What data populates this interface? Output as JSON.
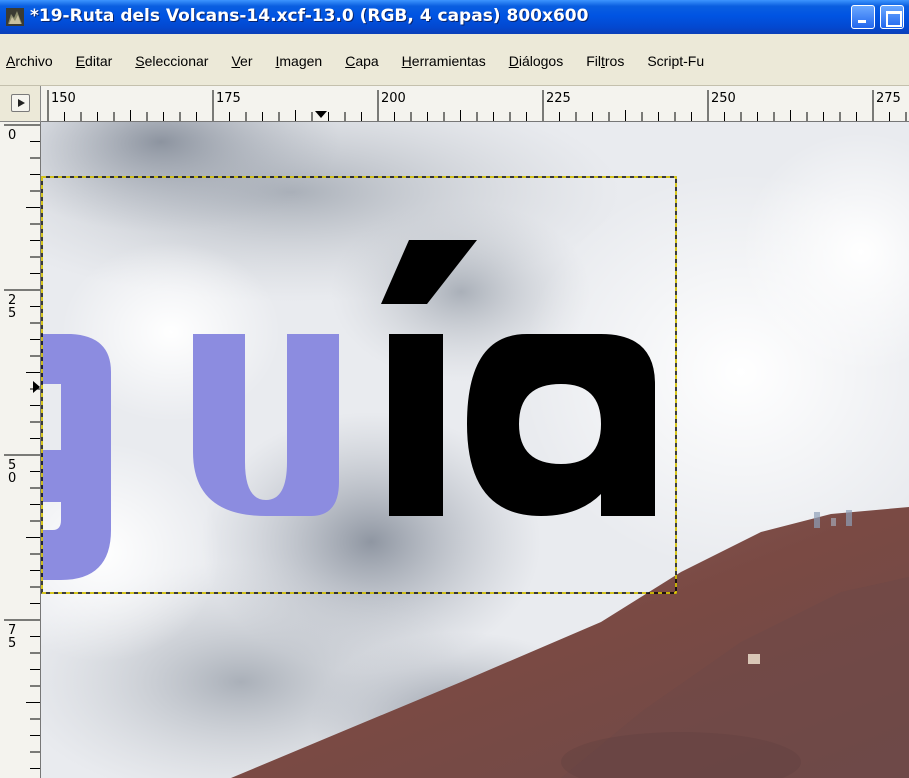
{
  "window": {
    "title": "*19-Ruta dels Volcans-14.xcf-13.0 (RGB, 4 capas) 800x600",
    "icon": "gimp-wilber-icon"
  },
  "menu": [
    {
      "label": "Archivo",
      "mnemonic": "A"
    },
    {
      "label": "Editar",
      "mnemonic": "E"
    },
    {
      "label": "Seleccionar",
      "mnemonic": "S"
    },
    {
      "label": "Ver",
      "mnemonic": "V"
    },
    {
      "label": "Imagen",
      "mnemonic": "I"
    },
    {
      "label": "Capa",
      "mnemonic": "C"
    },
    {
      "label": "Herramientas",
      "mnemonic": "H"
    },
    {
      "label": "Diálogos",
      "mnemonic": "D"
    },
    {
      "label": "Filtros",
      "mnemonic": "t"
    },
    {
      "label": "Script-Fu",
      "mnemonic": ""
    }
  ],
  "ruler": {
    "horizontal_labels": [
      "150",
      "175",
      "200",
      "225",
      "250",
      "275"
    ],
    "vertical_labels": [
      "0",
      "25",
      "50",
      "75"
    ]
  },
  "canvas": {
    "text_blue": "gu",
    "text_black": "ía",
    "colors": {
      "text_blue": "#8c8ce0",
      "text_black": "#000000",
      "selection": "#f5e000",
      "rock": "#7a4a44",
      "sky": "#e8eaee"
    }
  }
}
